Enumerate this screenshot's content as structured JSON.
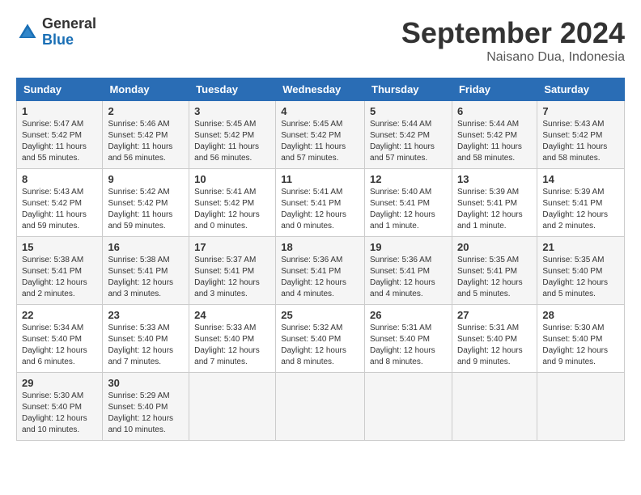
{
  "header": {
    "logo": {
      "general": "General",
      "blue": "Blue"
    },
    "title": "September 2024",
    "subtitle": "Naisano Dua, Indonesia"
  },
  "weekdays": [
    "Sunday",
    "Monday",
    "Tuesday",
    "Wednesday",
    "Thursday",
    "Friday",
    "Saturday"
  ],
  "weeks": [
    [
      {
        "day": "1",
        "info": "Sunrise: 5:47 AM\nSunset: 5:42 PM\nDaylight: 11 hours and 55 minutes."
      },
      {
        "day": "2",
        "info": "Sunrise: 5:46 AM\nSunset: 5:42 PM\nDaylight: 11 hours and 56 minutes."
      },
      {
        "day": "3",
        "info": "Sunrise: 5:45 AM\nSunset: 5:42 PM\nDaylight: 11 hours and 56 minutes."
      },
      {
        "day": "4",
        "info": "Sunrise: 5:45 AM\nSunset: 5:42 PM\nDaylight: 11 hours and 57 minutes."
      },
      {
        "day": "5",
        "info": "Sunrise: 5:44 AM\nSunset: 5:42 PM\nDaylight: 11 hours and 57 minutes."
      },
      {
        "day": "6",
        "info": "Sunrise: 5:44 AM\nSunset: 5:42 PM\nDaylight: 11 hours and 58 minutes."
      },
      {
        "day": "7",
        "info": "Sunrise: 5:43 AM\nSunset: 5:42 PM\nDaylight: 11 hours and 58 minutes."
      }
    ],
    [
      {
        "day": "8",
        "info": "Sunrise: 5:43 AM\nSunset: 5:42 PM\nDaylight: 11 hours and 59 minutes."
      },
      {
        "day": "9",
        "info": "Sunrise: 5:42 AM\nSunset: 5:42 PM\nDaylight: 11 hours and 59 minutes."
      },
      {
        "day": "10",
        "info": "Sunrise: 5:41 AM\nSunset: 5:42 PM\nDaylight: 12 hours and 0 minutes."
      },
      {
        "day": "11",
        "info": "Sunrise: 5:41 AM\nSunset: 5:41 PM\nDaylight: 12 hours and 0 minutes."
      },
      {
        "day": "12",
        "info": "Sunrise: 5:40 AM\nSunset: 5:41 PM\nDaylight: 12 hours and 1 minute."
      },
      {
        "day": "13",
        "info": "Sunrise: 5:39 AM\nSunset: 5:41 PM\nDaylight: 12 hours and 1 minute."
      },
      {
        "day": "14",
        "info": "Sunrise: 5:39 AM\nSunset: 5:41 PM\nDaylight: 12 hours and 2 minutes."
      }
    ],
    [
      {
        "day": "15",
        "info": "Sunrise: 5:38 AM\nSunset: 5:41 PM\nDaylight: 12 hours and 2 minutes."
      },
      {
        "day": "16",
        "info": "Sunrise: 5:38 AM\nSunset: 5:41 PM\nDaylight: 12 hours and 3 minutes."
      },
      {
        "day": "17",
        "info": "Sunrise: 5:37 AM\nSunset: 5:41 PM\nDaylight: 12 hours and 3 minutes."
      },
      {
        "day": "18",
        "info": "Sunrise: 5:36 AM\nSunset: 5:41 PM\nDaylight: 12 hours and 4 minutes."
      },
      {
        "day": "19",
        "info": "Sunrise: 5:36 AM\nSunset: 5:41 PM\nDaylight: 12 hours and 4 minutes."
      },
      {
        "day": "20",
        "info": "Sunrise: 5:35 AM\nSunset: 5:41 PM\nDaylight: 12 hours and 5 minutes."
      },
      {
        "day": "21",
        "info": "Sunrise: 5:35 AM\nSunset: 5:40 PM\nDaylight: 12 hours and 5 minutes."
      }
    ],
    [
      {
        "day": "22",
        "info": "Sunrise: 5:34 AM\nSunset: 5:40 PM\nDaylight: 12 hours and 6 minutes."
      },
      {
        "day": "23",
        "info": "Sunrise: 5:33 AM\nSunset: 5:40 PM\nDaylight: 12 hours and 7 minutes."
      },
      {
        "day": "24",
        "info": "Sunrise: 5:33 AM\nSunset: 5:40 PM\nDaylight: 12 hours and 7 minutes."
      },
      {
        "day": "25",
        "info": "Sunrise: 5:32 AM\nSunset: 5:40 PM\nDaylight: 12 hours and 8 minutes."
      },
      {
        "day": "26",
        "info": "Sunrise: 5:31 AM\nSunset: 5:40 PM\nDaylight: 12 hours and 8 minutes."
      },
      {
        "day": "27",
        "info": "Sunrise: 5:31 AM\nSunset: 5:40 PM\nDaylight: 12 hours and 9 minutes."
      },
      {
        "day": "28",
        "info": "Sunrise: 5:30 AM\nSunset: 5:40 PM\nDaylight: 12 hours and 9 minutes."
      }
    ],
    [
      {
        "day": "29",
        "info": "Sunrise: 5:30 AM\nSunset: 5:40 PM\nDaylight: 12 hours and 10 minutes."
      },
      {
        "day": "30",
        "info": "Sunrise: 5:29 AM\nSunset: 5:40 PM\nDaylight: 12 hours and 10 minutes."
      },
      {
        "day": "",
        "info": ""
      },
      {
        "day": "",
        "info": ""
      },
      {
        "day": "",
        "info": ""
      },
      {
        "day": "",
        "info": ""
      },
      {
        "day": "",
        "info": ""
      }
    ]
  ]
}
